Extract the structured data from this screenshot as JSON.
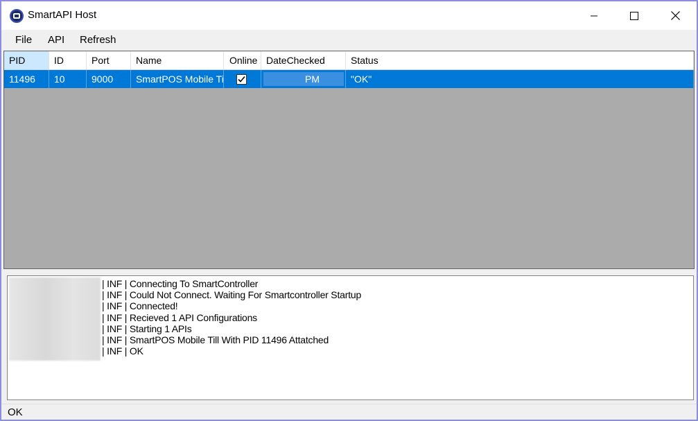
{
  "window": {
    "title": "SmartAPI Host",
    "controls": {
      "minimize": "minimize-icon",
      "maximize": "maximize-icon",
      "close": "close-icon"
    }
  },
  "menu": {
    "file": "File",
    "api": "API",
    "refresh": "Refresh"
  },
  "grid": {
    "columns": [
      "PID",
      "ID",
      "Port",
      "Name",
      "Online",
      "DateChecked",
      "Status"
    ],
    "rows": [
      {
        "pid": "11496",
        "id": "10",
        "port": "9000",
        "name": "SmartPOS Mobile Till",
        "online": true,
        "date_checked": "PM",
        "status": "\"OK\""
      }
    ]
  },
  "log": {
    "lines": [
      "| INF | Connecting To SmartController",
      "| INF | Could Not Connect. Waiting For Smartcontroller Startup",
      "| INF | Connected!",
      "| INF | Recieved 1 API Configurations",
      "| INF | Starting 1 APIs",
      "| INF | SmartPOS Mobile Till With PID 11496 Attatched",
      "| INF | OK"
    ]
  },
  "statusbar": {
    "text": "OK"
  },
  "colors": {
    "selection": "#0078d7",
    "header_selected": "#cce8ff",
    "grid_background": "#ababab",
    "window_border": "#8c8ce0"
  }
}
